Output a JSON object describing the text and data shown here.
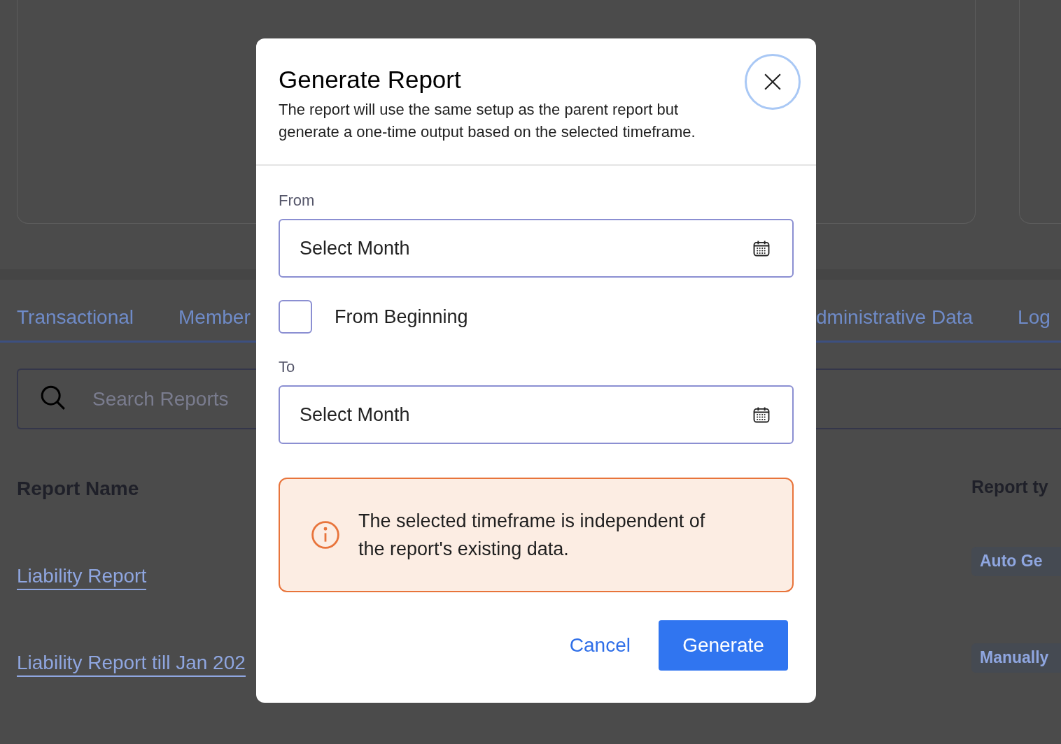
{
  "background": {
    "tabs": [
      {
        "label": "Transactional"
      },
      {
        "label": "Member"
      },
      {
        "label": "dministrative Data"
      },
      {
        "label": "Log"
      }
    ],
    "search": {
      "placeholder": "Search Reports"
    },
    "table": {
      "columns": [
        "Report Name",
        "Report ty"
      ],
      "rows": [
        {
          "name": "Liability Report",
          "type": "Auto Ge"
        },
        {
          "name": "Liability Report till Jan 202",
          "type": "Manually"
        }
      ]
    }
  },
  "dialog": {
    "title": "Generate Report",
    "description": "The report will use the same setup as the parent report but generate a one-time output based on the selected timeframe.",
    "from": {
      "label": "From",
      "placeholder": "Select Month"
    },
    "from_beginning": {
      "label": "From Beginning",
      "checked": false
    },
    "to": {
      "label": "To",
      "placeholder": "Select Month"
    },
    "alert": {
      "text": "The selected timeframe is independent of the report's existing data."
    },
    "buttons": [
      {
        "label": "Cancel",
        "kind": "link"
      },
      {
        "label": "Generate",
        "kind": "primary"
      }
    ]
  }
}
